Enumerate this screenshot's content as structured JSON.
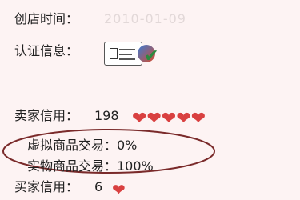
{
  "shop": {
    "created_label": "创店时间：",
    "created_value": "2010-01-09",
    "cert_label": "认证信息："
  },
  "credit": {
    "seller_label": "卖家信用：",
    "seller_value": "198",
    "virtual_line": "虚拟商品交易：0%",
    "physical_line": "实物商品交易：100%",
    "buyer_label": "买家信用：",
    "buyer_value": "6"
  },
  "icons": {
    "certificate": "certificate-card-icon",
    "verified": "verified-check-icon",
    "heart": "heart-icon"
  },
  "colors": {
    "heart": "#d94040",
    "annotation_ellipse": "#7a2a2a"
  }
}
